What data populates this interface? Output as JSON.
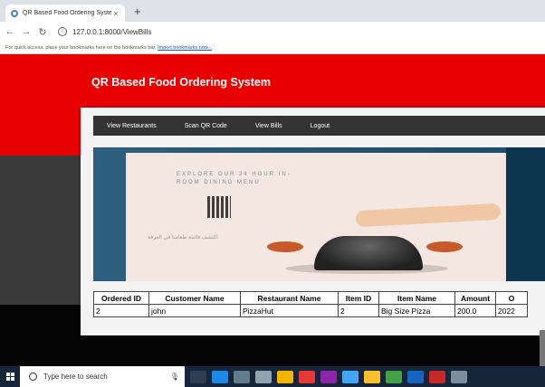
{
  "browser": {
    "tab_title": "QR Based Food Ordering System",
    "tab_close": "×",
    "new_tab": "+",
    "url": "127.0.0.1:8000/ViewBills",
    "bookmarks_text": "For quick access, place your bookmarks here on the bookmarks bar.",
    "bookmarks_link": "Import bookmarks now..."
  },
  "site": {
    "title": "QR Based Food Ordering System",
    "menu": [
      "View Restaurants",
      "Scan QR Code",
      "View Bills",
      "Logout"
    ]
  },
  "hero": {
    "promo_text": "EXPLORE OUR 24 HOUR IN-ROOM DINING MENU",
    "arabic_text": "اكتشف قائمة طعامنا في الغرفة"
  },
  "bills_table": {
    "headers": [
      "Ordered ID",
      "Customer Name",
      "Restaurant Name",
      "Item ID",
      "Item Name",
      "Amount",
      "O"
    ],
    "rows": [
      [
        "2",
        "john",
        "PizzaHut",
        "2",
        "Big Size Pizza",
        "200.0",
        "2022"
      ]
    ]
  },
  "taskbar": {
    "search_placeholder": "Type here to search"
  },
  "colors": {
    "brand_red": "#e80000",
    "menu_bg": "#333333",
    "taskbar": "#17253a"
  }
}
